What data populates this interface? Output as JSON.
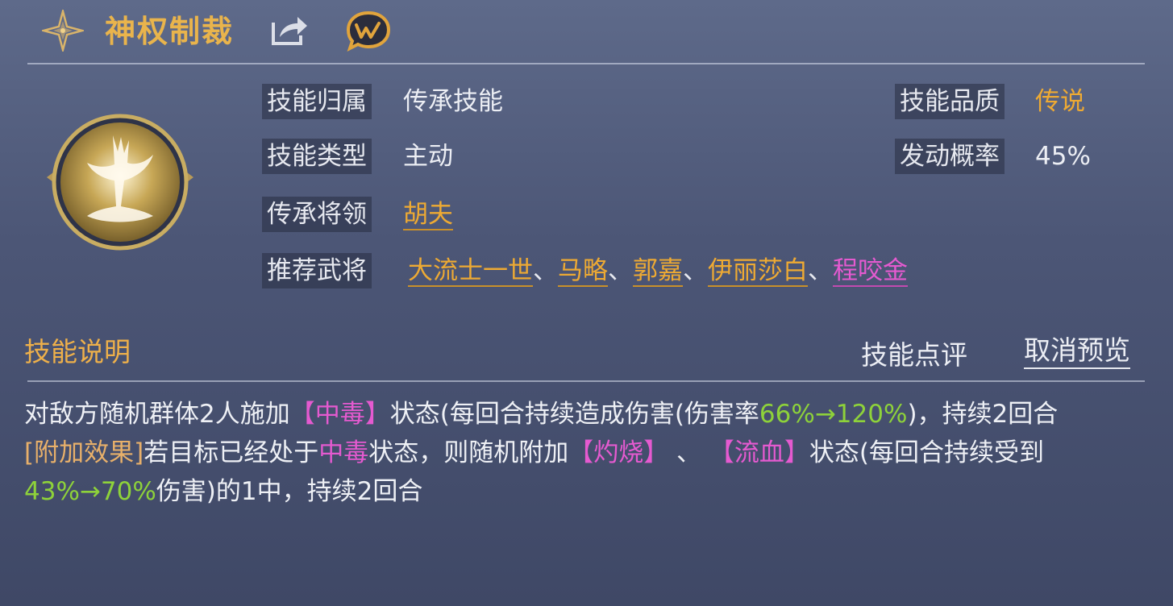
{
  "header": {
    "title": "神权制裁",
    "icons": [
      "star-compass-icon",
      "share-icon",
      "w-chat-icon"
    ]
  },
  "attributes": {
    "ownership_label": "技能归属",
    "ownership_value": "传承技能",
    "quality_label": "技能品质",
    "quality_value": "传说",
    "type_label": "技能类型",
    "type_value": "主动",
    "rate_label": "发动概率",
    "rate_value": "45%",
    "general_label": "传承将领",
    "general_value": "胡夫",
    "recommend_label": "推荐武将",
    "recommended": [
      "大流士一世",
      "马略",
      "郭嘉",
      "伊丽莎白",
      "程咬金"
    ],
    "separator": "、"
  },
  "section": {
    "title": "技能说明",
    "review_link": "技能点评",
    "cancel_preview_link": "取消预览"
  },
  "description": {
    "p1_a": "对敌方随机群体2人施加",
    "p1_tag": "【中毒】",
    "p1_b": "状态(每回合持续造成伤害(伤害率",
    "p1_rate": "66%→120%",
    "p1_c": ")，持续2回合",
    "p2_tag": "[附加效果]",
    "p2_a": "若目标已经处于",
    "p2_state": "中毒",
    "p2_b": "状态，则随机附加",
    "p2_tag1": "【灼烧】",
    "p2_sep": " 、 ",
    "p2_tag2": "【流血】",
    "p2_c": "状态(每回合持续受到",
    "p2_rate": "43%→70%",
    "p2_d": "伤害)的1中，持续2回合"
  },
  "colors": {
    "gold": "#eeaa33",
    "pink": "#e55ad0",
    "green": "#8ed23a",
    "background": "#4c5676"
  }
}
